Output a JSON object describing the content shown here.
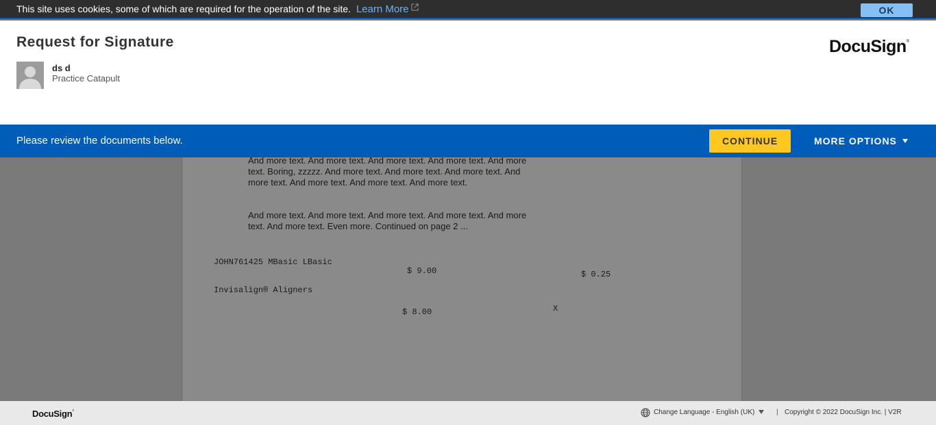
{
  "cookie_banner": {
    "text": "This site uses cookies, some of which are required for the operation of the site.",
    "link_label": "Learn More",
    "ok_label": "OK"
  },
  "header": {
    "title": "Request for Signature",
    "sender_name": "ds d",
    "sender_org": "Practice Catapult",
    "brand": "DocuSign",
    "brand_mark": "®"
  },
  "action_bar": {
    "message": "Please review the documents below.",
    "continue_label": "CONTINUE",
    "more_options_label": "MORE OPTIONS"
  },
  "document": {
    "paragraph_1": "And more text. And more text. And more text. And more text. And more text. Boring, zzzzz. And more text. And more text. And more text. And more text. And more text. And more text. And more text.",
    "paragraph_2": "And more text. And more text. And more text. And more text. And more text. And more text. Even more. Continued on page 2 ...",
    "item_1_name": "JOHN761425 MBasic LBasic",
    "item_1_price": "$ 9.00",
    "item_1_extra": "$ 0.25",
    "item_2_name": "Invisalign® Aligners",
    "item_2_price": "$ 8.00",
    "item_2_mark": "X"
  },
  "footer": {
    "brand": "DocuSign",
    "brand_mark": "®",
    "language_label": "Change Language - English (UK)",
    "separator": "|",
    "copyright": "Copyright © 2022 DocuSign Inc. | V2R"
  },
  "colors": {
    "action_bar": "#005cb9",
    "continue_button": "#ffc820",
    "cookie_bar": "#2e2e2e",
    "cookie_ok": "#86bff4"
  },
  "icons": {
    "external_link": "external-link-icon",
    "avatar": "user-silhouette-icon",
    "more_caret": "caret-down-icon",
    "language": "globe-icon",
    "language_caret": "caret-down-icon"
  }
}
